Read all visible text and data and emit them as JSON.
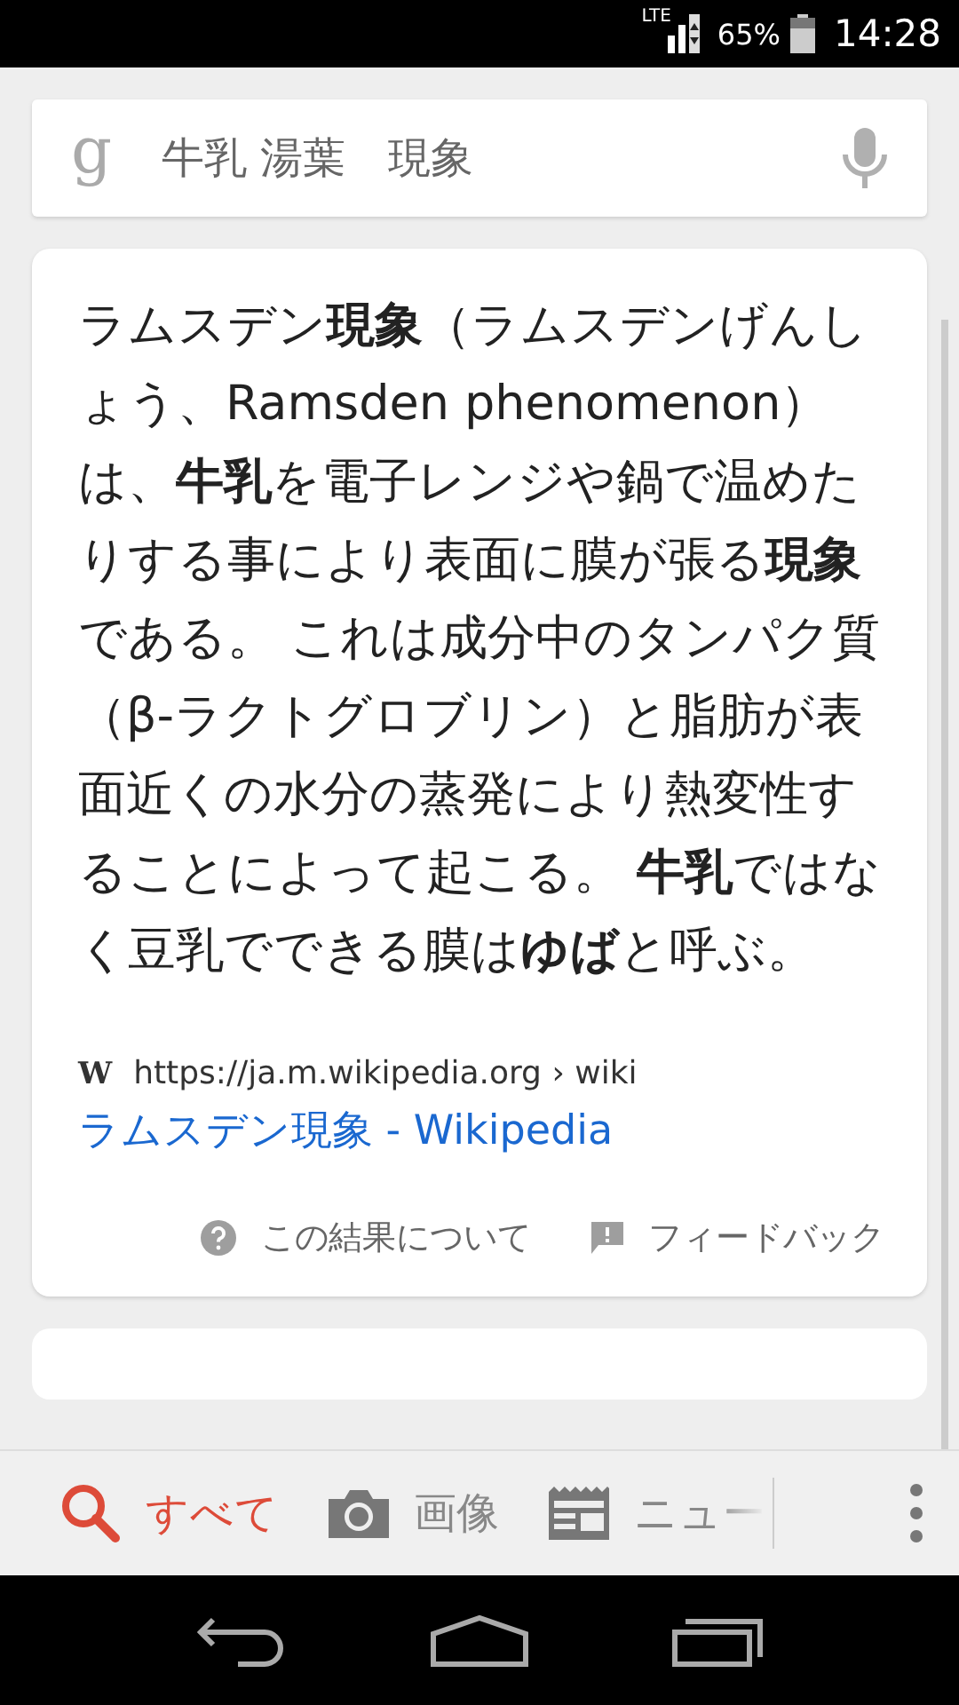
{
  "status_bar": {
    "network": "LTE",
    "battery": "65%",
    "time": "14:28"
  },
  "search": {
    "logo": "g",
    "query": "牛乳 湯葉　現象"
  },
  "result": {
    "snippet": "ラムスデン**現象**（ラムスデンげんしょう、Ramsden phenomenon）は、**牛乳**を電子レンジや鍋で温めたりする事により表面に膜が張る**現象**である。 これは成分中のタンパク質（β-ラクトグロブリン）と脂肪が表面近くの水分の蒸発により熱変性することによって起こる。 **牛乳**ではなく豆乳でできる膜は**ゆば**と呼ぶ。",
    "site_icon": "W",
    "url": "https://ja.m.wikipedia.org › wiki",
    "title": "ラムスデン現象 - Wikipedia",
    "about": "この結果について",
    "feedback": "フィードバック"
  },
  "tabs": [
    {
      "label": "すべて",
      "kind": "search",
      "selected": true
    },
    {
      "label": "画像",
      "kind": "camera",
      "selected": false
    },
    {
      "label": "ニュー",
      "kind": "news",
      "selected": false
    }
  ]
}
